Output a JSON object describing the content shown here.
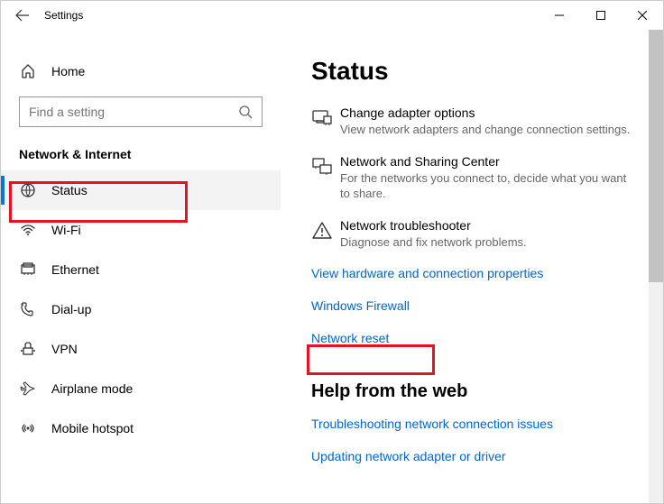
{
  "window": {
    "title": "Settings"
  },
  "sidebar": {
    "home_label": "Home",
    "search_placeholder": "Find a setting",
    "section_header": "Network & Internet",
    "items": [
      {
        "label": "Status"
      },
      {
        "label": "Wi-Fi"
      },
      {
        "label": "Ethernet"
      },
      {
        "label": "Dial-up"
      },
      {
        "label": "VPN"
      },
      {
        "label": "Airplane mode"
      },
      {
        "label": "Mobile hotspot"
      }
    ]
  },
  "main": {
    "heading": "Status",
    "options": [
      {
        "title": "Change adapter options",
        "desc": "View network adapters and change connection settings."
      },
      {
        "title": "Network and Sharing Center",
        "desc": "For the networks you connect to, decide what you want to share."
      },
      {
        "title": "Network troubleshooter",
        "desc": "Diagnose and fix network problems."
      }
    ],
    "links": [
      "View hardware and connection properties",
      "Windows Firewall",
      "Network reset"
    ],
    "help_heading": "Help from the web",
    "help_links": [
      "Troubleshooting network connection issues",
      "Updating network adapter or driver"
    ]
  }
}
